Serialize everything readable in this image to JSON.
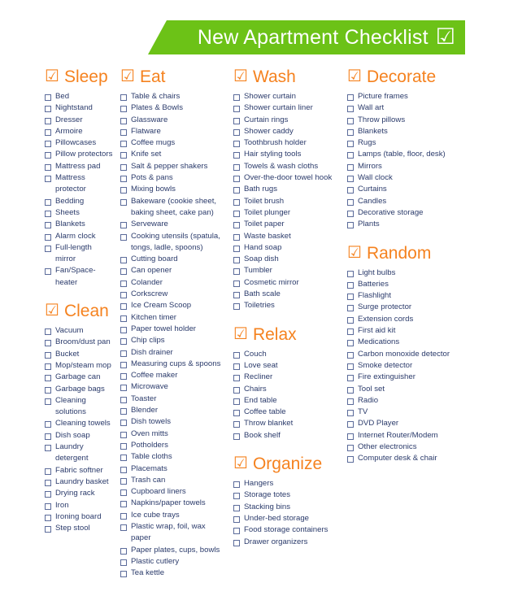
{
  "banner": {
    "title": "New Apartment Checklist",
    "check_icon": "☑",
    "color": "#6CC217",
    "text_color": "#FFFFFF"
  },
  "theme": {
    "heading_color": "#F5821F",
    "item_text_color": "#2B3B6B",
    "checkbox_border_color": "#5B6B9A",
    "background": "#FFFFFF"
  },
  "section_icon": "☑",
  "columns": [
    {
      "sections": [
        {
          "title": "Sleep",
          "items": [
            "Bed",
            "Nightstand",
            "Dresser",
            "Armoire",
            "Pillowcases",
            "Pillow protectors",
            "Mattress pad",
            "Mattress protector",
            "Bedding",
            "Sheets",
            "Blankets",
            "Alarm clock",
            "Full-length mirror",
            "Fan/Space-heater"
          ]
        },
        {
          "title": "Clean",
          "items": [
            "Vacuum",
            "Broom/dust pan",
            "Bucket",
            "Mop/steam mop",
            "Garbage can",
            "Garbage bags",
            "Cleaning solutions",
            "Cleaning towels",
            "Dish soap",
            "Laundry detergent",
            "Fabric softner",
            "Laundry basket",
            "Drying rack",
            "Iron",
            "Ironing board",
            "Step stool"
          ]
        }
      ]
    },
    {
      "sections": [
        {
          "title": "Eat",
          "items": [
            "Table & chairs",
            "Plates & Bowls",
            "Glassware",
            "Flatware",
            "Coffee mugs",
            "Knife set",
            "Salt & pepper shakers",
            "Pots & pans",
            "Mixing bowls",
            "Bakeware (cookie sheet, baking sheet, cake pan)",
            "Serveware",
            "Cooking utensils (spatula, tongs, ladle, spoons)",
            "Cutting board",
            "Can opener",
            "Colander",
            "Corkscrew",
            "Ice Cream Scoop",
            "Kitchen timer",
            "Paper towel holder",
            "Chip clips",
            "Dish drainer",
            "Measuring cups & spoons",
            "Coffee maker",
            "Microwave",
            "Toaster",
            "Blender",
            "Dish towels",
            "Oven mitts",
            "Potholders",
            "Table cloths",
            "Placemats",
            "Trash can",
            "Cupboard liners",
            "Napkins/paper towels",
            "Ice cube trays",
            "Plastic wrap, foil, wax paper",
            "Paper plates, cups, bowls",
            "Plastic cutlery",
            "Tea kettle"
          ]
        }
      ]
    },
    {
      "sections": [
        {
          "title": "Wash",
          "items": [
            "Shower curtain",
            "Shower curtain liner",
            "Curtain rings",
            "Shower caddy",
            "Toothbrush holder",
            "Hair styling tools",
            "Towels & wash cloths",
            "Over-the-door towel hook",
            "Bath rugs",
            "Toilet brush",
            "Toilet plunger",
            "Toilet paper",
            "Waste basket",
            "Hand soap",
            "Soap dish",
            "Tumbler",
            "Cosmetic mirror",
            "Bath scale",
            "Toiletries"
          ]
        },
        {
          "title": "Relax",
          "items": [
            "Couch",
            "Love seat",
            "Recliner",
            "Chairs",
            "End table",
            "Coffee table",
            "Throw blanket",
            "Book shelf"
          ]
        },
        {
          "title": "Organize",
          "items": [
            "Hangers",
            "Storage totes",
            "Stacking bins",
            "Under-bed storage",
            "Food storage containers",
            "Drawer organizers"
          ]
        }
      ]
    },
    {
      "sections": [
        {
          "title": "Decorate",
          "items": [
            "Picture frames",
            "Wall art",
            "Throw pillows",
            "Blankets",
            "Rugs",
            "Lamps (table, floor, desk)",
            "Mirrors",
            "Wall clock",
            "Curtains",
            "Candles",
            "Decorative storage",
            "Plants"
          ]
        },
        {
          "title": "Random",
          "items": [
            "Light bulbs",
            "Batteries",
            "Flashlight",
            "Surge protector",
            "Extension cords",
            "First aid kit",
            "Medications",
            "Carbon monoxide detector",
            "Smoke detector",
            "Fire extinguisher",
            "Tool set",
            "Radio",
            "TV",
            "DVD Player",
            "Internet Router/Modem",
            "Other electronics",
            "Computer desk & chair"
          ]
        }
      ]
    }
  ]
}
